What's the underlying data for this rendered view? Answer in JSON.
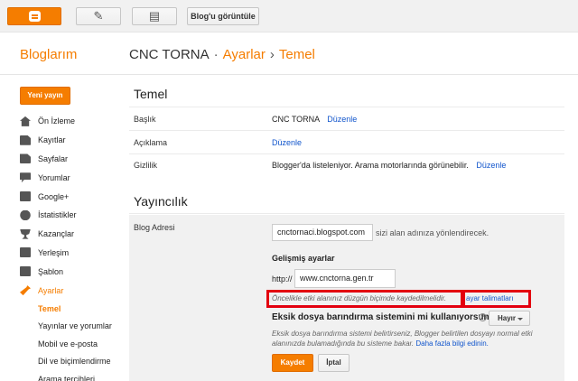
{
  "toolbar": {
    "blogger_icon": "blogger-logo-icon",
    "pencil_icon": "✎",
    "pages_icon": "▤",
    "view_blog_label": "Blog'u görüntüle"
  },
  "header": {
    "site_title": "Bloglarım",
    "blog_name": "CNC TORNA",
    "sep1": "·",
    "section": "Ayarlar",
    "sep2": "›",
    "page": "Temel"
  },
  "sidebar": {
    "new_post_label": "Yeni yayın",
    "items": [
      {
        "label": "Ön İzleme",
        "icon": "home-icon"
      },
      {
        "label": "Kayıtlar",
        "icon": "posts-icon"
      },
      {
        "label": "Sayfalar",
        "icon": "pages-icon"
      },
      {
        "label": "Yorumlar",
        "icon": "comments-icon"
      },
      {
        "label": "Google+",
        "icon": "google-plus-icon"
      },
      {
        "label": "İstatistikler",
        "icon": "stats-icon"
      },
      {
        "label": "Kazançlar",
        "icon": "earnings-icon"
      },
      {
        "label": "Yerleşim",
        "icon": "layout-icon"
      },
      {
        "label": "Şablon",
        "icon": "template-icon"
      },
      {
        "label": "Ayarlar",
        "icon": "wrench-icon"
      }
    ],
    "subitems": [
      {
        "label": "Temel"
      },
      {
        "label": "Yayınlar ve yorumlar"
      },
      {
        "label": "Mobil ve e-posta"
      },
      {
        "label": "Dil ve biçimlendirme"
      },
      {
        "label": "Arama tercihleri"
      }
    ]
  },
  "basic": {
    "title": "Temel",
    "rows": [
      {
        "label": "Başlık",
        "value": "CNC TORNA",
        "link": "Düzenle"
      },
      {
        "label": "Açıklama",
        "value": "",
        "link": "Düzenle"
      },
      {
        "label": "Gizlilik",
        "value": "Blogger'da listeleniyor. Arama motorlarında görünebilir.",
        "link": "Düzenle"
      }
    ]
  },
  "publishing": {
    "title": "Yayıncılık",
    "blog_address_label": "Blog Adresi",
    "address_value": "cnctornaci.blogspot.com",
    "address_note": "sizi alan adınıza yönlendirecek.",
    "advanced_title": "Gelişmiş ayarlar",
    "http_prefix": "http://",
    "custom_domain": "www.cnctorna.gen.tr",
    "warning_text": "Öncelikle etki alanınız düzgün biçimde kaydedilmelidir.",
    "warning_link": "ayar talimatları",
    "missing_files_question": "Eksik dosya barındırma sistemini mi kullanıyorsunuz?",
    "help_icon": "?",
    "missing_files_value": "Hayır",
    "description": "Eksik dosya barındırma sistemi belirtirseniz, Blogger belirtilen dosyayı normal etki alanınızda bulamadığında bu sisteme bakar.",
    "more_info_link": "Daha fazla bilgi edinin.",
    "save_label": "Kaydet",
    "cancel_label": "İptal"
  },
  "colors": {
    "accent": "#f57d00",
    "link": "#1155cc",
    "highlight_box": "#e3000f"
  }
}
